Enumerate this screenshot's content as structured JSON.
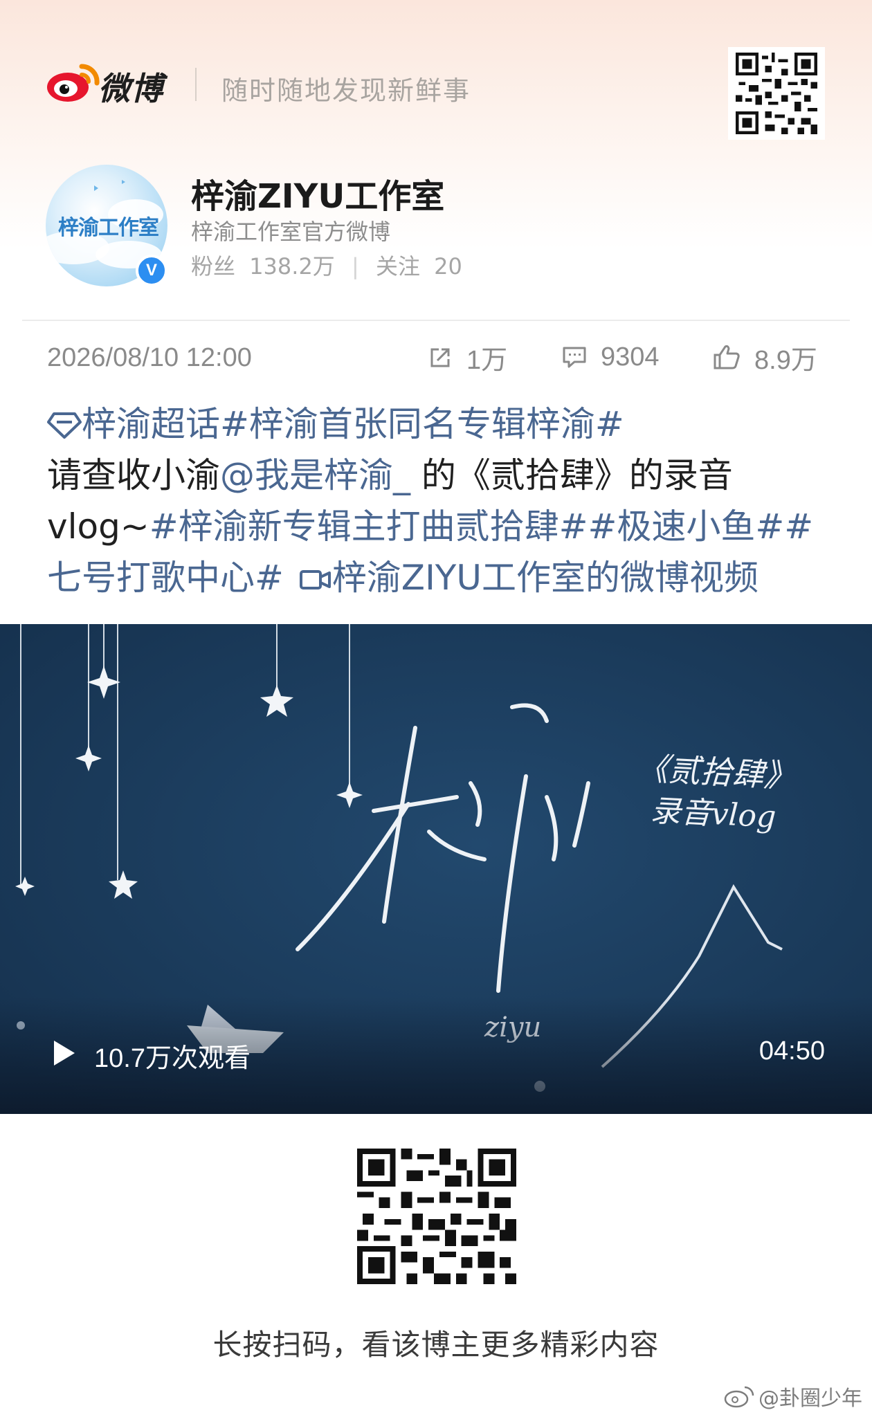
{
  "header": {
    "brand": "微博",
    "slogan": "随时随地发现新鲜事"
  },
  "profile": {
    "name": "梓渝ZIYU工作室",
    "description": "梓渝工作室官方微博",
    "avatar_text": "梓渝工作室",
    "fans_label": "粉丝",
    "fans_count": "138.2万",
    "following_label": "关注",
    "following_count": "20"
  },
  "post": {
    "timestamp": "2026/08/10 12:00",
    "reposts": "1万",
    "comments": "9304",
    "likes": "8.9万",
    "text": {
      "line1_topics": "梓渝超话#梓渝首张同名专辑梓渝#",
      "line2_a": "请查收小渝",
      "line2_mention": "@我是梓渝_",
      "line2_b": " 的《贰拾肆》的录音",
      "line3_a": "vlog~",
      "line3_topics": "#梓渝新专辑主打曲贰拾肆##极速小鱼##",
      "line4_topic": "七号打歌中心#",
      "line4_video": "梓渝ZIYU工作室的微博视频"
    }
  },
  "video": {
    "cover_title": "梓渝",
    "cover_subtitle_1": "《贰拾肆》",
    "cover_subtitle_2": "录音vlog",
    "cover_signature": "ziyu",
    "view_count": "10.7万次观看",
    "duration": "04:50"
  },
  "footer": {
    "qr_caption": "长按扫码，看该博主更多精彩内容",
    "watermark": "@卦圈少年"
  },
  "colors": {
    "link_blue": "#4a6791",
    "video_bg": "#1a3a5c",
    "verified_blue": "#2c8ef1"
  }
}
